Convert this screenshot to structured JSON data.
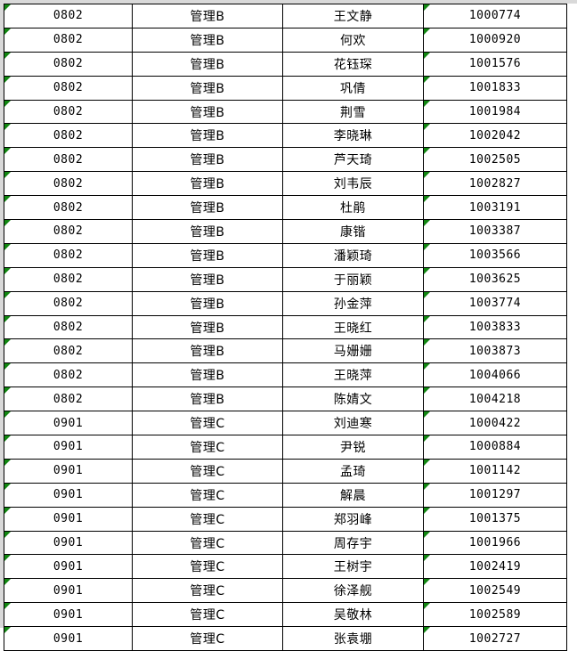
{
  "app": {
    "type": "spreadsheet-grid",
    "error_flag_color": "#128712",
    "grid_line_color": "#000000",
    "background_color": "#ffffff",
    "gutter_color": "#d9d9d9"
  },
  "table": {
    "column_count": 4,
    "row_count": 27,
    "columns": [
      {
        "key": "code",
        "align": "center",
        "flagged": true
      },
      {
        "key": "group",
        "align": "center",
        "flagged": false
      },
      {
        "key": "name",
        "align": "center",
        "flagged": false
      },
      {
        "key": "id",
        "align": "center",
        "flagged": true
      }
    ],
    "rows": [
      {
        "code": "0802",
        "group": "管理B",
        "name": "王文静",
        "id": "1000774"
      },
      {
        "code": "0802",
        "group": "管理B",
        "name": "何欢",
        "id": "1000920"
      },
      {
        "code": "0802",
        "group": "管理B",
        "name": "花钰琛",
        "id": "1001576"
      },
      {
        "code": "0802",
        "group": "管理B",
        "name": "巩倩",
        "id": "1001833"
      },
      {
        "code": "0802",
        "group": "管理B",
        "name": "荆雪",
        "id": "1001984"
      },
      {
        "code": "0802",
        "group": "管理B",
        "name": "李晓琳",
        "id": "1002042"
      },
      {
        "code": "0802",
        "group": "管理B",
        "name": "芦天琦",
        "id": "1002505"
      },
      {
        "code": "0802",
        "group": "管理B",
        "name": "刘韦辰",
        "id": "1002827"
      },
      {
        "code": "0802",
        "group": "管理B",
        "name": "杜鹃",
        "id": "1003191"
      },
      {
        "code": "0802",
        "group": "管理B",
        "name": "康锴",
        "id": "1003387"
      },
      {
        "code": "0802",
        "group": "管理B",
        "name": "潘颖琦",
        "id": "1003566"
      },
      {
        "code": "0802",
        "group": "管理B",
        "name": "于丽颖",
        "id": "1003625"
      },
      {
        "code": "0802",
        "group": "管理B",
        "name": "孙金萍",
        "id": "1003774"
      },
      {
        "code": "0802",
        "group": "管理B",
        "name": "王晓红",
        "id": "1003833"
      },
      {
        "code": "0802",
        "group": "管理B",
        "name": "马姗姗",
        "id": "1003873"
      },
      {
        "code": "0802",
        "group": "管理B",
        "name": "王晓萍",
        "id": "1004066"
      },
      {
        "code": "0802",
        "group": "管理B",
        "name": "陈婧文",
        "id": "1004218"
      },
      {
        "code": "0901",
        "group": "管理C",
        "name": "刘迪寒",
        "id": "1000422"
      },
      {
        "code": "0901",
        "group": "管理C",
        "name": "尹锐",
        "id": "1000884"
      },
      {
        "code": "0901",
        "group": "管理C",
        "name": "孟琦",
        "id": "1001142"
      },
      {
        "code": "0901",
        "group": "管理C",
        "name": "解晨",
        "id": "1001297"
      },
      {
        "code": "0901",
        "group": "管理C",
        "name": "郑羽峰",
        "id": "1001375"
      },
      {
        "code": "0901",
        "group": "管理C",
        "name": "周存宇",
        "id": "1001966"
      },
      {
        "code": "0901",
        "group": "管理C",
        "name": "王树宇",
        "id": "1002419"
      },
      {
        "code": "0901",
        "group": "管理C",
        "name": "徐泽舰",
        "id": "1002549"
      },
      {
        "code": "0901",
        "group": "管理C",
        "name": "吴敬林",
        "id": "1002589"
      },
      {
        "code": "0901",
        "group": "管理C",
        "name": "张袁堋",
        "id": "1002727"
      }
    ]
  }
}
